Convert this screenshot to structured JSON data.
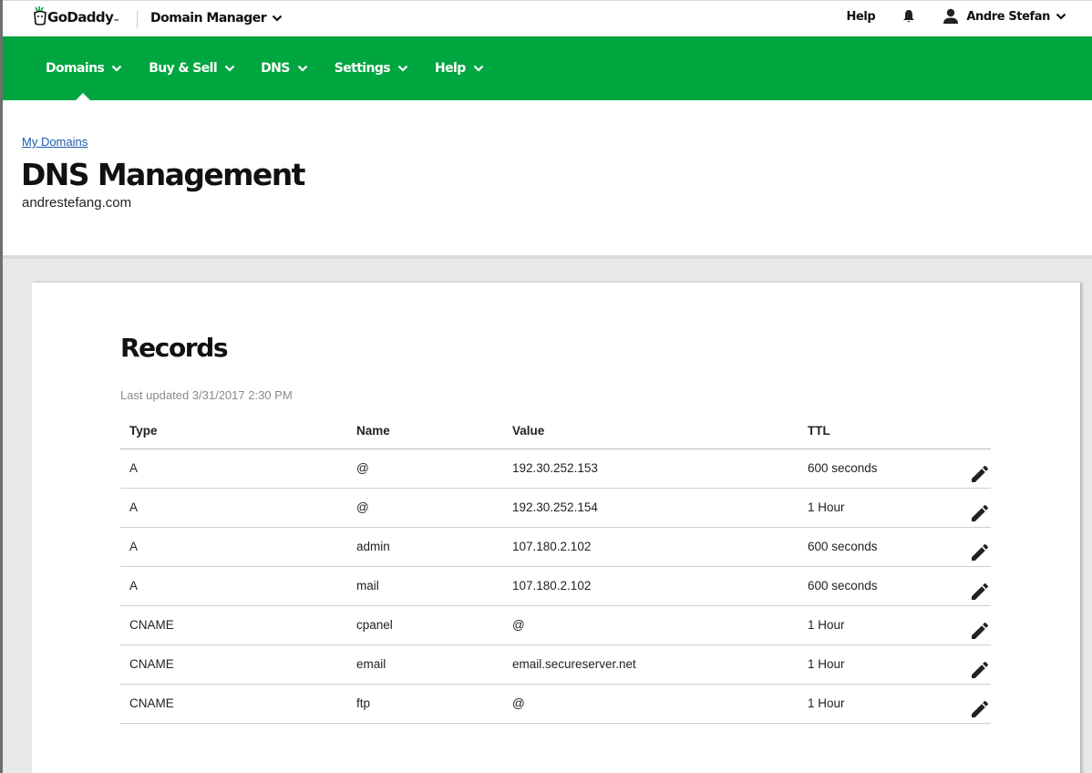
{
  "topbar": {
    "brand": "GoDaddy",
    "brand_tm": "™",
    "app_name": "Domain Manager",
    "help_label": "Help",
    "user_name": "Andre Stefan"
  },
  "nav": {
    "items": [
      {
        "label": "Domains"
      },
      {
        "label": "Buy & Sell"
      },
      {
        "label": "DNS"
      },
      {
        "label": "Settings"
      },
      {
        "label": "Help"
      }
    ],
    "active": "Domains",
    "color": "#00a63f"
  },
  "header": {
    "breadcrumb": "My Domains",
    "title": "DNS Management",
    "domain": "andrestefang.com"
  },
  "records": {
    "title": "Records",
    "last_updated": "Last updated 3/31/2017 2:30 PM",
    "columns": [
      "Type",
      "Name",
      "Value",
      "TTL"
    ],
    "rows": [
      {
        "type": "A",
        "name": "@",
        "value": "192.30.252.153",
        "ttl": "600 seconds"
      },
      {
        "type": "A",
        "name": "@",
        "value": "192.30.252.154",
        "ttl": "1 Hour"
      },
      {
        "type": "A",
        "name": "admin",
        "value": "107.180.2.102",
        "ttl": "600 seconds"
      },
      {
        "type": "A",
        "name": "mail",
        "value": "107.180.2.102",
        "ttl": "600 seconds"
      },
      {
        "type": "CNAME",
        "name": "cpanel",
        "value": "@",
        "ttl": "1 Hour"
      },
      {
        "type": "CNAME",
        "name": "email",
        "value": "email.secureserver.net",
        "ttl": "1 Hour"
      },
      {
        "type": "CNAME",
        "name": "ftp",
        "value": "@",
        "ttl": "1 Hour"
      }
    ]
  },
  "icons": {
    "logo": "godaddy-logo-icon",
    "bell": "bell-icon",
    "user": "user-icon",
    "chevron": "chevron-down-icon",
    "edit": "pencil-icon"
  }
}
